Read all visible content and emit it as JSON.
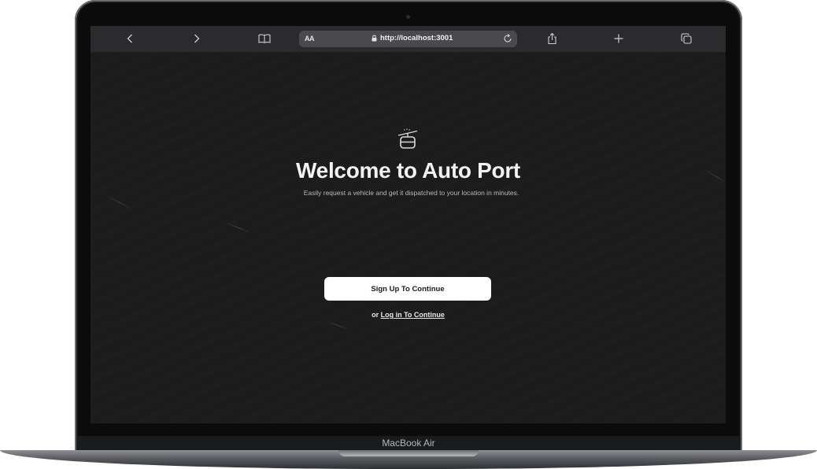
{
  "browser": {
    "text_size_label": "AA",
    "url": "http://localhost:3001",
    "icons": {
      "back": "chevron-left-icon",
      "forward": "chevron-right-icon",
      "bookmarks": "book-icon",
      "lock": "lock-icon",
      "reload": "reload-icon",
      "share": "share-icon",
      "new_tab": "plus-icon",
      "tabs": "tabs-icon"
    }
  },
  "page": {
    "logo_icon": "cable-car-icon",
    "title": "Welcome to Auto Port",
    "subtitle": "Easily request a vehicle and get it dispatched to your location in minutes.",
    "signup_label": "Sign Up To Continue",
    "login_prefix": "or",
    "login_label": "Log in To Continue"
  },
  "device": {
    "brand": "MacBook Air"
  },
  "colors": {
    "page_background": "#1c1c1d",
    "toolbar_background": "#2b2b2d",
    "address_bar": "#4a4a4e",
    "button_background": "#ffffff",
    "text_primary": "#f2f2f3"
  }
}
